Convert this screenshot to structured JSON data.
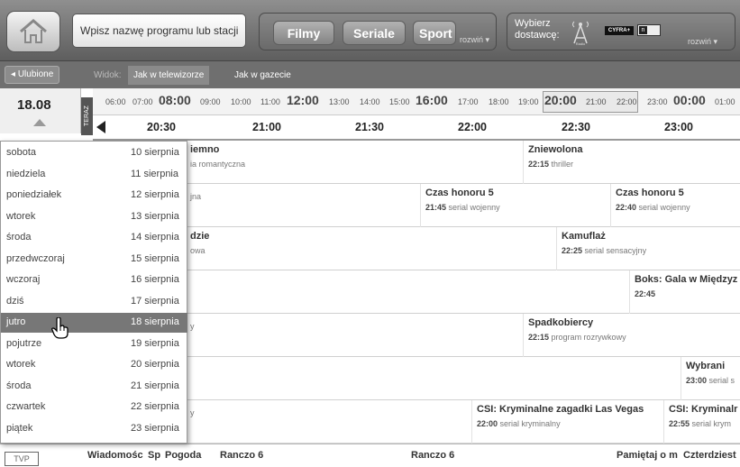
{
  "topbar": {
    "search_placeholder": "Wpisz nazwę programu lub stacji",
    "nav": [
      {
        "label": "Filmy"
      },
      {
        "label": "Seriale"
      },
      {
        "label": "Sport"
      }
    ],
    "nav_expand": "rozwiń",
    "provider_label": "Wybierz dostawcę:",
    "provider_logos": [
      "Radio",
      "CYFRA+",
      "n"
    ],
    "provider_expand": "rozwiń"
  },
  "toolbar": {
    "favorites": "Ulubione",
    "view_label": "Widok:",
    "view_tv": "Jak w telewizorze",
    "view_paper": "Jak w gazecie"
  },
  "date_selector": {
    "current": "18.08",
    "tab_label": "TERAZ"
  },
  "hour_strip": [
    "06:00",
    "07:00",
    "08:00",
    "09:00",
    "10:00",
    "11:00",
    "12:00",
    "13:00",
    "14:00",
    "15:00",
    "16:00",
    "17:00",
    "18:00",
    "19:00",
    "20:00",
    "21:00",
    "22:00",
    "23:00",
    "00:00",
    "01:00"
  ],
  "time_header": [
    "20:30",
    "21:00",
    "21:30",
    "22:00",
    "22:30",
    "23:00"
  ],
  "schedule": [
    [
      {
        "title": "iemno",
        "genre": "ia romantyczna",
        "time": ""
      },
      {
        "title": "Zniewolona",
        "genre": "thriller",
        "time": "22:15"
      }
    ],
    [
      {
        "title": "",
        "genre": "jna",
        "time": ""
      },
      {
        "title": "Czas honoru 5",
        "genre": "serial wojenny",
        "time": "21:45"
      },
      {
        "title": "Czas honoru 5",
        "genre": "serial wojenny",
        "time": "22:40"
      }
    ],
    [
      {
        "title": "dzie",
        "genre": "owa",
        "time": ""
      },
      {
        "title": "Kamuflaż",
        "genre": "serial sensacyjny",
        "time": "22:25"
      }
    ],
    [
      {
        "title": "",
        "genre": "",
        "time": ""
      },
      {
        "title": "Boks: Gala w Międzyz",
        "genre": "",
        "time": "22:45"
      }
    ],
    [
      {
        "title": "",
        "genre": "y",
        "time": ""
      },
      {
        "title": "Spadkobiercy",
        "genre": "program rozrywkowy",
        "time": "22:15"
      }
    ],
    [
      {
        "title": "",
        "genre": "",
        "time": ""
      },
      {
        "title": "Wybrani",
        "genre": "serial s",
        "time": "23:00"
      }
    ],
    [
      {
        "title": "",
        "genre": "y",
        "time": ""
      },
      {
        "title": "CSI: Kryminalne zagadki Las Vegas",
        "genre": "serial kryminalny",
        "time": "22:00"
      },
      {
        "title": "CSI: Kryminalr",
        "genre": "serial krym",
        "time": "22:55"
      }
    ]
  ],
  "last_row": {
    "channel_logo": "TVP",
    "items": [
      "Wiadomośc",
      "Sp",
      "Pogoda",
      "Ranczo 6",
      "Ranczo 6",
      "Pamiętaj o m",
      "Czterdziest"
    ]
  },
  "day_list": [
    {
      "name": "sobota",
      "date": "10 sierpnia"
    },
    {
      "name": "niedziela",
      "date": "11 sierpnia"
    },
    {
      "name": "poniedziałek",
      "date": "12 sierpnia"
    },
    {
      "name": "wtorek",
      "date": "13 sierpnia"
    },
    {
      "name": "środa",
      "date": "14 sierpnia"
    },
    {
      "name": "przedwczoraj",
      "date": "15 sierpnia"
    },
    {
      "name": "wczoraj",
      "date": "16 sierpnia"
    },
    {
      "name": "dziś",
      "date": "17 sierpnia"
    },
    {
      "name": "jutro",
      "date": "18 sierpnia"
    },
    {
      "name": "pojutrze",
      "date": "19 sierpnia"
    },
    {
      "name": "wtorek",
      "date": "20 sierpnia"
    },
    {
      "name": "środa",
      "date": "21 sierpnia"
    },
    {
      "name": "czwartek",
      "date": "22 sierpnia"
    },
    {
      "name": "piątek",
      "date": "23 sierpnia"
    }
  ],
  "selected_day_index": 8
}
